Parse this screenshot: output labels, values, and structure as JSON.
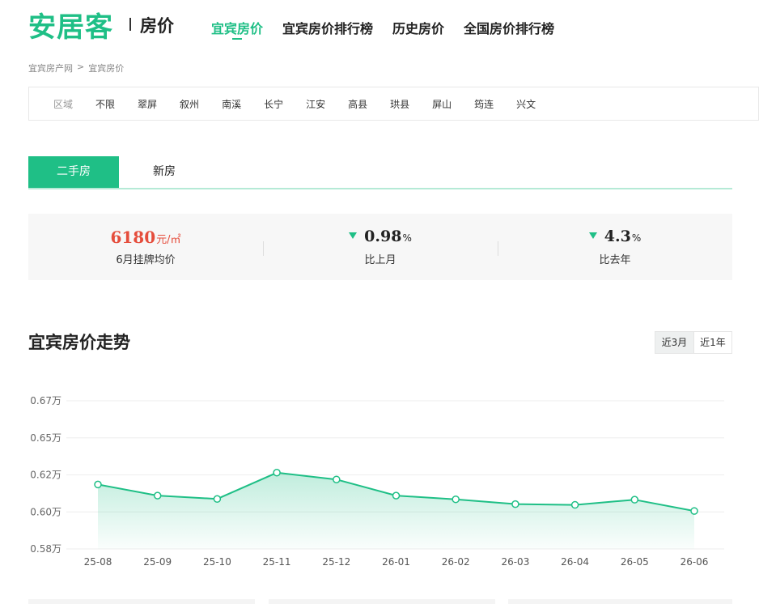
{
  "header": {
    "logo": "安居客",
    "subtitle": "房价",
    "nav": [
      {
        "label": "宜宾房价",
        "active": true
      },
      {
        "label": "宜宾房价排行榜",
        "active": false
      },
      {
        "label": "历史房价",
        "active": false
      },
      {
        "label": "全国房价排行榜",
        "active": false
      }
    ]
  },
  "breadcrumb": [
    "宜宾房产网",
    ">",
    "宜宾房价"
  ],
  "filter": {
    "label": "区域",
    "items": [
      "不限",
      "翠屏",
      "叙州",
      "南溪",
      "长宁",
      "江安",
      "高县",
      "珙县",
      "屏山",
      "筠连",
      "兴文"
    ]
  },
  "tabs": [
    {
      "label": "二手房",
      "active": true
    },
    {
      "label": "新房",
      "active": false
    }
  ],
  "stats": {
    "price": {
      "value": "6180",
      "unit": "元/㎡",
      "label": "6月挂牌均价"
    },
    "mom": {
      "value": "0.98",
      "unit": "%",
      "label": "比上月",
      "direction": "down"
    },
    "yoy": {
      "value": "4.3",
      "unit": "%",
      "label": "比去年",
      "direction": "down"
    }
  },
  "trend": {
    "title": "宜宾房价走势",
    "ranges": [
      {
        "label": "近3月",
        "active": true
      },
      {
        "label": "近1年",
        "active": false
      }
    ]
  },
  "colors": {
    "brand": "#1fbf86",
    "price": "#e54d3c"
  },
  "chart_data": {
    "type": "area",
    "categories": [
      "25-08",
      "25-09",
      "25-10",
      "25-11",
      "25-12",
      "26-01",
      "26-02",
      "26-03",
      "26-04",
      "26-05",
      "26-06"
    ],
    "values": [
      0.6248,
      0.6188,
      0.617,
      0.6312,
      0.6275,
      0.6188,
      0.6168,
      0.6142,
      0.6138,
      0.6166,
      0.6105
    ],
    "yticks": [
      "0.67万",
      "0.65万",
      "0.62万",
      "0.60万",
      "0.58万"
    ],
    "ytick_values": [
      0.67,
      0.65,
      0.63,
      0.61,
      0.59
    ],
    "ylim": [
      0.59,
      0.67
    ],
    "grid": true
  }
}
